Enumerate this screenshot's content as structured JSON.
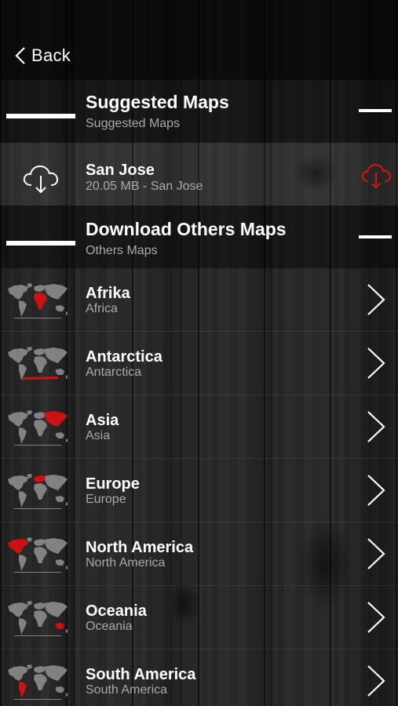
{
  "nav": {
    "back_label": "Back"
  },
  "suggested": {
    "title": "Suggested Maps",
    "subtitle": "Suggested Maps",
    "items": [
      {
        "title": "San Jose",
        "subtitle": "20.05 MB - San Jose",
        "accent": "#e01010"
      }
    ]
  },
  "others": {
    "title": "Download Others Maps",
    "subtitle": "Others Maps",
    "items": [
      {
        "title": "Afrika",
        "subtitle": "Africa",
        "region": "africa"
      },
      {
        "title": "Antarctica",
        "subtitle": "Antarctica",
        "region": "antarctica"
      },
      {
        "title": "Asia",
        "subtitle": "Asia",
        "region": "asia"
      },
      {
        "title": "Europe",
        "subtitle": "Europe",
        "region": "europe"
      },
      {
        "title": "North America",
        "subtitle": "North America",
        "region": "north-america"
      },
      {
        "title": "Oceania",
        "subtitle": "Oceania",
        "region": "oceania"
      },
      {
        "title": "South America",
        "subtitle": "South America",
        "region": "south-america"
      }
    ]
  },
  "colors": {
    "accent": "#e01010",
    "map_land": "#8c8c8c"
  }
}
